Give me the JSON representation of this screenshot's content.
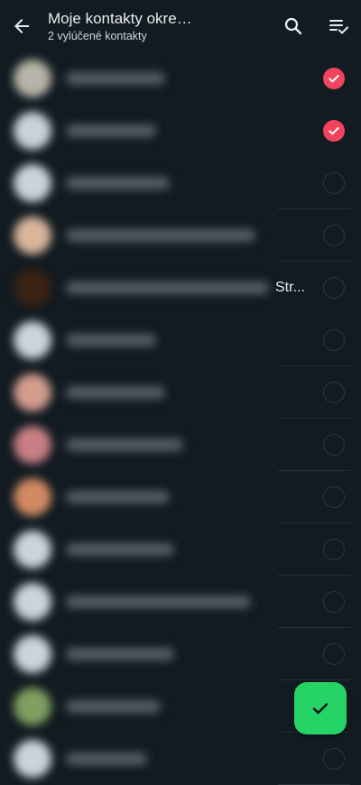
{
  "header": {
    "title": "Moje kontakty okrem…",
    "subtitle": "2 vylúčené kontakty",
    "back_icon": "arrow-back-icon",
    "search_icon": "search-icon",
    "select_all_icon": "select-all-icon"
  },
  "contacts": [
    {
      "selected": true,
      "partial_name": ""
    },
    {
      "selected": true,
      "partial_name": ""
    },
    {
      "selected": false,
      "partial_name": ""
    },
    {
      "selected": false,
      "partial_name": ""
    },
    {
      "selected": false,
      "partial_name": "Str..."
    },
    {
      "selected": false,
      "partial_name": ""
    },
    {
      "selected": false,
      "partial_name": ""
    },
    {
      "selected": false,
      "partial_name": ""
    },
    {
      "selected": false,
      "partial_name": ""
    },
    {
      "selected": false,
      "partial_name": ""
    },
    {
      "selected": false,
      "partial_name": ""
    },
    {
      "selected": false,
      "partial_name": ""
    },
    {
      "selected": false,
      "partial_name": ""
    },
    {
      "selected": false,
      "partial_name": ""
    }
  ],
  "fab": {
    "icon": "check-icon"
  },
  "colors": {
    "background": "#111b21",
    "selected_check": "#f0445e",
    "fab": "#25d366"
  }
}
